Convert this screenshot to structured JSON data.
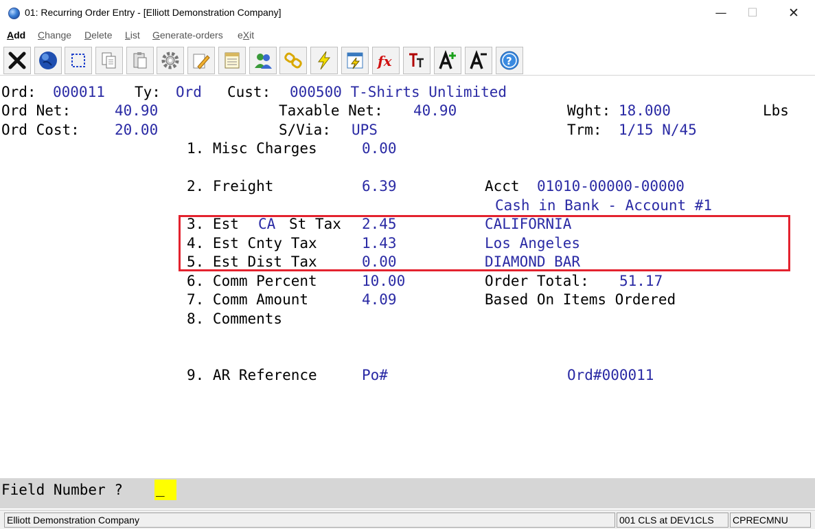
{
  "window": {
    "title": "01: Recurring Order Entry - [Elliott Demonstration Company]",
    "minimize": "—",
    "maximize": "☐",
    "close": "✕"
  },
  "menu": {
    "add": {
      "u": "A",
      "rest": "dd"
    },
    "change": {
      "u": "C",
      "rest": "hange"
    },
    "delete": {
      "u": "D",
      "rest": "elete"
    },
    "list": {
      "u": "L",
      "rest": "ist"
    },
    "generate": {
      "u": "G",
      "rest": "enerate-orders"
    },
    "exit": {
      "pre": "e",
      "u": "X",
      "rest": "it"
    }
  },
  "toolbar": {
    "icons": [
      "close-x-icon",
      "globe-icon",
      "select-rect-icon",
      "copy-icon",
      "paste-icon",
      "gear-icon",
      "edit-pencil-icon",
      "notepad-icon",
      "users-icon",
      "link-icon",
      "lightning-icon",
      "calculator-icon",
      "fx-icon",
      "text-size-icon",
      "font-increase-icon",
      "font-decrease-icon",
      "help-icon"
    ],
    "fx_label": "fx"
  },
  "header": {
    "ord_label": "Ord:",
    "ord_value": "000011",
    "ty_label": "Ty:",
    "ty_value": "Ord",
    "cust_label": "Cust:",
    "cust_value": "000500 T-Shirts Unlimited",
    "ord_net_label": "Ord Net:",
    "ord_net_value": "40.90",
    "taxable_net_label": "Taxable Net:",
    "taxable_net_value": "40.90",
    "wght_label": "Wght:",
    "wght_value": "18.000",
    "wght_unit": "Lbs",
    "ord_cost_label": "Ord Cost:",
    "ord_cost_value": "20.00",
    "svia_label": "S/Via:",
    "svia_value": "UPS",
    "trm_label": "Trm:",
    "trm_value": "1/15 N/45"
  },
  "fields": {
    "f1_label": "1. Misc Charges",
    "f1_value": "0.00",
    "f2_label": "2. Freight",
    "f2_value": "6.39",
    "acct_label": "Acct",
    "acct_value": "01010-00000-00000",
    "acct_desc": "Cash in Bank - Account #1",
    "f3_label_a": "3. Est",
    "f3_label_ca": "CA",
    "f3_label_b": "St Tax",
    "f3_value": "2.45",
    "f3_juris": "CALIFORNIA",
    "f4_label": "4. Est Cnty Tax",
    "f4_value": "1.43",
    "f4_juris": "Los Angeles",
    "f5_label": "5. Est Dist Tax",
    "f5_value": "0.00",
    "f5_juris": "DIAMOND BAR",
    "f6_label": "6. Comm Percent",
    "f6_value": "10.00",
    "order_total_label": "Order Total:",
    "order_total_value": "51.17",
    "f7_label": "7. Comm Amount",
    "f7_value": "4.09",
    "based_on": "Based On Items Ordered",
    "f8_label": "8. Comments",
    "f9_label": "9. AR Reference",
    "f9_value": "Po#",
    "f9_ord": "Ord#000011"
  },
  "prompt": {
    "label": "Field Number ?",
    "value": "_"
  },
  "status": {
    "company": "Elliott Demonstration Company",
    "session": "001 CLS at DEV1CLS",
    "menu_code": "CPRECMNU"
  },
  "colors": {
    "value_text": "#2a2aa4",
    "highlight_box": "#e3222e",
    "input_bg": "#ffff00"
  }
}
